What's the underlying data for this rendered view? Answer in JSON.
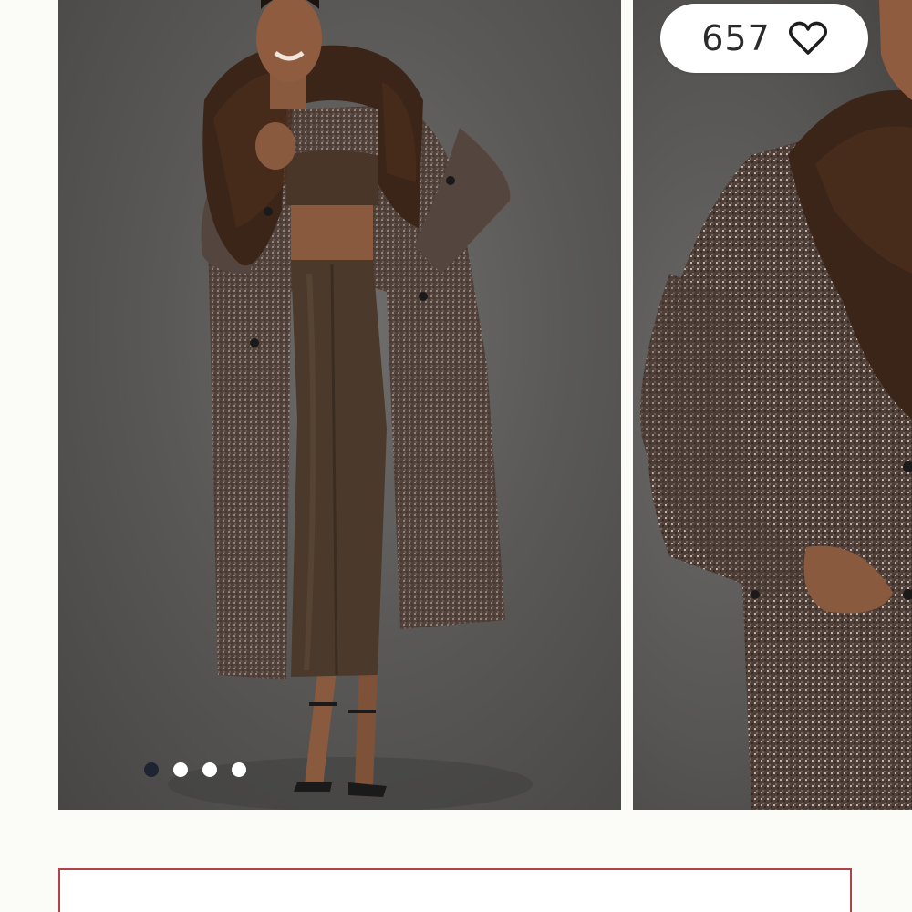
{
  "gallery": {
    "main_image": {
      "alt": ""
    },
    "second_image": {
      "alt": ""
    },
    "dots": {
      "count": 4,
      "active_index": 0
    }
  },
  "like": {
    "count": "657",
    "icon": "heart-outline-icon"
  },
  "colors": {
    "page_background": "#fbfbf8",
    "dot_active": "#1f2433",
    "dot_inactive": "#ffffff",
    "cta_border": "#b2424a"
  }
}
